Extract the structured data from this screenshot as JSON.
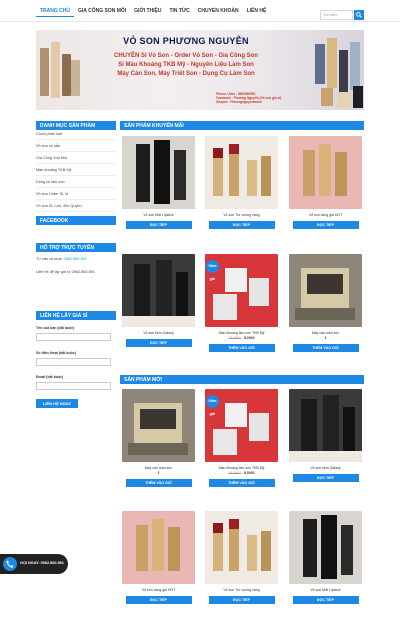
{
  "nav": {
    "items": [
      "Trang chủ",
      "Gia Công Son Môi",
      "Giới thiệu",
      "Tin tức",
      "Chuyển khoản",
      "Liên hệ"
    ],
    "search_placeholder": "Tìm kiếm"
  },
  "banner": {
    "title": "VỎ SON PHƯƠNG NGUYỄN",
    "line1": "CHUYÊN Sỉ Vỏ Son - Order Vỏ Son - Gia Công Son",
    "line2": "Sỉ Màu Khoáng TKB Mỹ - Nguyên Liệu Làm Son",
    "line3": "Máy Cán Son, Máy Triết Son - Dụng Cụ Làm Son",
    "info1": "Phone / Zalo : 0962860591",
    "info2": "Facebook : Phương Nguyễn (Vỏ son giá sỉ)",
    "info3": "Shopee : Phuongnguyenmami"
  },
  "sidebar": {
    "categories_title": "Danh mục sản phẩm",
    "categories": [
      "Chưa phân loại",
      "Vỏ son có sẵn",
      "Gia Công Son Môi",
      "Màu khoáng TKB Mỹ",
      "Dụng cụ làm son",
      "Vỏ son Order SL lố",
      "Vỏ son SL Lớn, độc Quyền"
    ],
    "facebook_title": "Facebook",
    "support_title": "Hỗ trợ trực tuyến",
    "support_sales_label": "Tư vấn và mua",
    "support_sales_phone": "0962.860.591",
    "support_wholesale": "Liên hệ để lấy giá sỉ: 0962.860.591",
    "contact_title": "Liên hệ lấy giá sỉ",
    "field_name": "Tên của bạn (bắt buộc)",
    "field_phone": "Số điện thoại (bắt buộc)",
    "field_email": "Email (bắt buộc)",
    "submit": "LIÊN HỆ NGAY"
  },
  "promo": {
    "title": "Sản phẩm khuyến mãi",
    "products": [
      {
        "name": "Vỏ son Mát Lipstick",
        "old": "",
        "price": "",
        "button": "ĐỌC TIẾP",
        "sale": false
      },
      {
        "name": "Vỏ son Trơ vuông vàng",
        "old": "",
        "price": "",
        "button": "ĐỌC TIẾP",
        "sale": false
      },
      {
        "name": "Vỏ son vàng gai HOT",
        "old": "",
        "price": "",
        "button": "ĐỌC TIẾP",
        "sale": false
      },
      {
        "name": "Vỏ son kem Galaxy",
        "old": "",
        "price": "",
        "button": "ĐỌC TIẾP",
        "sale": false
      },
      {
        "name": "Màu khoáng làm son TKB Mỹ",
        "old": "15,000₫",
        "price": "8,000₫",
        "button": "THÊM VÀO GIỎ",
        "sale": true,
        "sale_label": "Giảm giá!"
      },
      {
        "name": "Máy cán màu son",
        "old": "",
        "price": "₫",
        "button": "THÊM VÀO GIỎ",
        "sale": false
      }
    ]
  },
  "new": {
    "title": "Sản phẩm mới",
    "products": [
      {
        "name": "Máy cán màu son",
        "old": "",
        "price": "₫",
        "button": "THÊM VÀO GIỎ",
        "sale": false
      },
      {
        "name": "Màu khoáng làm son TKB Mỹ",
        "old": "15,000₫",
        "price": "8,000₫",
        "button": "THÊM VÀO GIỎ",
        "sale": true,
        "sale_label": "Giảm giá!"
      },
      {
        "name": "Vỏ son kem Galaxy",
        "old": "",
        "price": "",
        "button": "ĐỌC TIẾP",
        "sale": false
      },
      {
        "name": "Vỏ son vàng gai HOT",
        "old": "",
        "price": "",
        "button": "ĐỌC TIẾP",
        "sale": false
      },
      {
        "name": "Vỏ son Trơ vuông vàng",
        "old": "",
        "price": "",
        "button": "ĐỌC TIẾP",
        "sale": false
      },
      {
        "name": "Vỏ son Mát Lipstick",
        "old": "",
        "price": "",
        "button": "ĐỌC TIẾP",
        "sale": false
      }
    ]
  },
  "call": {
    "label": "GỌI NGAY: 0962.860.591"
  },
  "colors": {
    "accent": "#1e88e5",
    "banner_title": "#0d1a4d",
    "banner_red": "#c0392b"
  }
}
